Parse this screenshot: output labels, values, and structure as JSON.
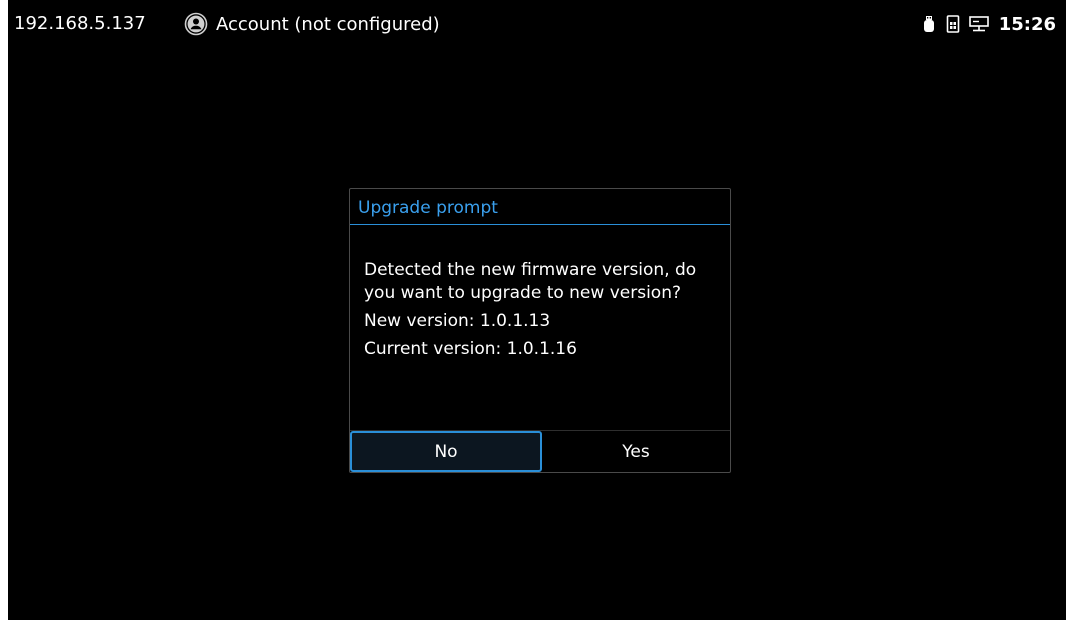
{
  "status_bar": {
    "ip_address": "192.168.5.137",
    "account_label": "Account (not configured)",
    "account_icon": "account-circle-icon",
    "icons": [
      "usb-icon",
      "sim-card-icon",
      "network-icon"
    ],
    "time": "15:26"
  },
  "dialog": {
    "title": "Upgrade prompt",
    "message": "Detected the new firmware version, do you want to upgrade to new version?",
    "new_version_line": "New version: 1.0.1.13",
    "current_version_line": "Current version: 1.0.1.16",
    "buttons": {
      "no_label": "No",
      "yes_label": "Yes"
    },
    "focused_button": "No"
  },
  "colors": {
    "background": "#000000",
    "accent": "#2a8fd8",
    "title_text": "#3aa0ee",
    "text": "#ffffff"
  }
}
